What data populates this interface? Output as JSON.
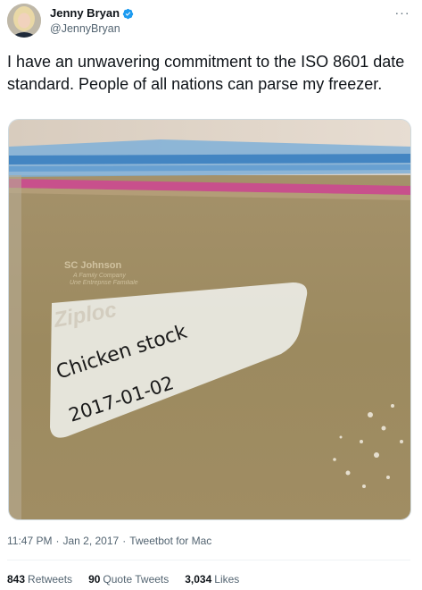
{
  "author": {
    "name": "Jenny Bryan",
    "handle": "@JennyBryan",
    "verified_color": "#1d9bf0"
  },
  "more_icon": "more-horizontal-icon",
  "tweet": {
    "text": "I have an unwavering commitment to the ISO 8601 date standard. People of all nations can parse my freezer."
  },
  "image": {
    "bag_brand_small": "SC Johnson",
    "bag_tagline_1": "A Family Company",
    "bag_tagline_2": "Une Entreprise Familiale",
    "brand": "Ziploc",
    "handwritten_line_1": "Chicken stock",
    "handwritten_line_2": "2017-01-02"
  },
  "meta": {
    "time": "11:47 PM",
    "sep1": "·",
    "date": "Jan 2, 2017",
    "sep2": "·",
    "source": "Tweetbot for Mac"
  },
  "stats": {
    "retweets_count": "843",
    "retweets_label": "Retweets",
    "quotes_count": "90",
    "quotes_label": "Quote Tweets",
    "likes_count": "3,034",
    "likes_label": "Likes"
  }
}
